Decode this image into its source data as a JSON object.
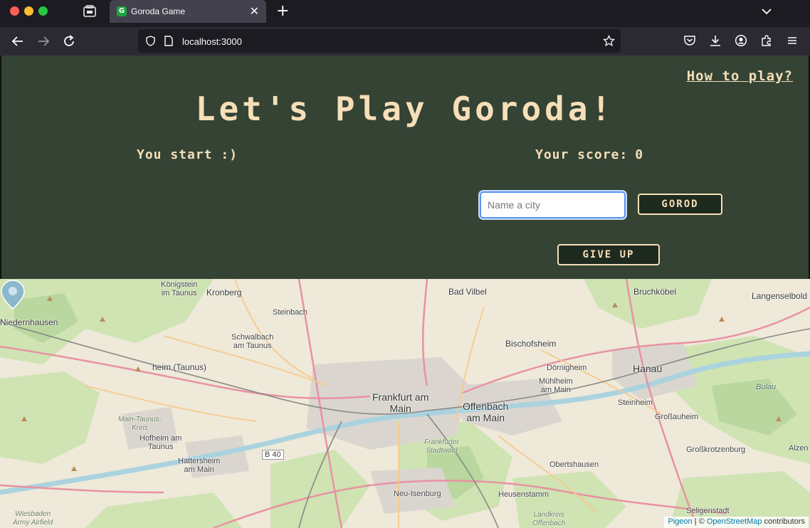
{
  "browser": {
    "tab_title": "Goroda Game",
    "tab_favicon": "G",
    "url": "localhost:3000",
    "icons": [
      "back-icon",
      "forward-icon",
      "reload-icon",
      "shield-icon",
      "page-icon",
      "star-icon",
      "pocket-icon",
      "download-icon",
      "account-icon",
      "extensions-icon",
      "menu-icon"
    ]
  },
  "game": {
    "how_to_play": "How to play?",
    "title": "Let's Play Goroda!",
    "status": "You start :)",
    "score_label": "Your score:",
    "score_value": "0",
    "input_placeholder": "Name a city",
    "submit_label": "GOROD",
    "give_up_label": "GIVE UP"
  },
  "map": {
    "marker_city": "Frankfurt am Main",
    "places": {
      "koenigstein": "Königstein\nim Taunus",
      "kronberg": "Kronberg",
      "bad_vilbel": "Bad Vilbel",
      "bruchkoebel": "Bruchköbel",
      "langenselbold": "Langenselbold",
      "niedernhausen": "Niedernhausen",
      "steinbach": "Steinbach",
      "schwalbach": "Schwalbach\nam Taunus",
      "bischofsheim": "Bischofsheim",
      "eppstein": "heim (Taunus)",
      "doernigheim": "Dörnigheim",
      "muehlheim": "Mühlheim\nam Main",
      "hanau": "Hanau",
      "frankfurt": "Frankfurt am\nMain",
      "offenbach": "Offenbach\nam Main",
      "steinheim": "Steinheim",
      "grossauheim": "Großauheim",
      "bulau": "Bulau",
      "main_taunus": "Main-Taunus-\nKreis",
      "hofheim": "Hofheim am\nTaunus",
      "hattersheim": "Hattersheim\nam Main",
      "frankfurter_stadtwald": "Frankfurter\nStadtwald",
      "grosskrotzenburg": "Großkrotzenburg",
      "alzenau": "Alzen",
      "obertshausen": "Obertshausen",
      "neu_isenburg": "Neu-Isenburg",
      "heusenstamm": "Heusenstamm",
      "seligenstadt": "Seligenstadt",
      "landkreis": "Landkreis\nOffenbach",
      "wiesbaden": "Wiesbaden\nArmy Airfield",
      "b40": "B 40"
    },
    "attribution_pigeon": "Pigeon",
    "attribution_sep": " | © ",
    "attribution_osm": "OpenStreetMap",
    "attribution_tail": " contributors"
  }
}
